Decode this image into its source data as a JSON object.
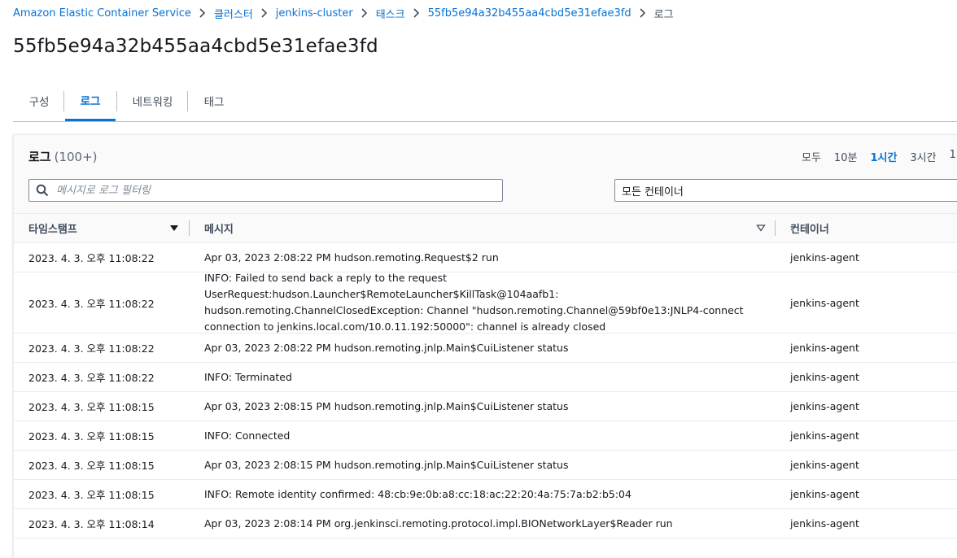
{
  "breadcrumb": [
    "Amazon Elastic Container Service",
    "클러스터",
    "jenkins-cluster",
    "태스크",
    "55fb5e94a32b455aa4cbd5e31efae3fd",
    "로그"
  ],
  "page_title": "55fb5e94a32b455aa4cbd5e31efae3fd",
  "tabs": [
    "구성",
    "로그",
    "네트워킹",
    "태그"
  ],
  "active_tab": "로그",
  "logs": {
    "title": "로그",
    "count": "(100+)",
    "time_ranges": [
      "모두",
      "10분",
      "1시간",
      "3시간",
      "1"
    ],
    "selected_range": "1시간",
    "search_placeholder": "메시지로 로그 필터링",
    "container_select": "모든 컨테이너",
    "columns": [
      "타임스탬프",
      "메시지",
      "컨테이너"
    ],
    "rows": [
      {
        "timestamp": "2023. 4. 3. 오후 11:08:22",
        "message": "Apr 03, 2023 2:08:22 PM hudson.remoting.Request$2 run",
        "container": "jenkins-agent"
      },
      {
        "timestamp": "2023. 4. 3. 오후 11:08:22",
        "message": "INFO: Failed to send back a reply to the request UserRequest:hudson.Launcher$RemoteLauncher$KillTask@104aafb1: hudson.remoting.ChannelClosedException: Channel \"hudson.remoting.Channel@59bf0e13:JNLP4-connect connection to jenkins.local.com/10.0.11.192:50000\": channel is already closed",
        "container": "jenkins-agent"
      },
      {
        "timestamp": "2023. 4. 3. 오후 11:08:22",
        "message": "Apr 03, 2023 2:08:22 PM hudson.remoting.jnlp.Main$CuiListener status",
        "container": "jenkins-agent"
      },
      {
        "timestamp": "2023. 4. 3. 오후 11:08:22",
        "message": "INFO: Terminated",
        "container": "jenkins-agent"
      },
      {
        "timestamp": "2023. 4. 3. 오후 11:08:15",
        "message": "Apr 03, 2023 2:08:15 PM hudson.remoting.jnlp.Main$CuiListener status",
        "container": "jenkins-agent"
      },
      {
        "timestamp": "2023. 4. 3. 오후 11:08:15",
        "message": "INFO: Connected",
        "container": "jenkins-agent"
      },
      {
        "timestamp": "2023. 4. 3. 오후 11:08:15",
        "message": "Apr 03, 2023 2:08:15 PM hudson.remoting.jnlp.Main$CuiListener status",
        "container": "jenkins-agent"
      },
      {
        "timestamp": "2023. 4. 3. 오후 11:08:15",
        "message": "INFO: Remote identity confirmed: 48:cb:9e:0b:a8:cc:18:ac:22:20:4a:75:7a:b2:b5:04",
        "container": "jenkins-agent"
      },
      {
        "timestamp": "2023. 4. 3. 오후 11:08:14",
        "message": "Apr 03, 2023 2:08:14 PM org.jenkinsci.remoting.protocol.impl.BIONetworkLayer$Reader run",
        "container": "jenkins-agent"
      }
    ]
  }
}
